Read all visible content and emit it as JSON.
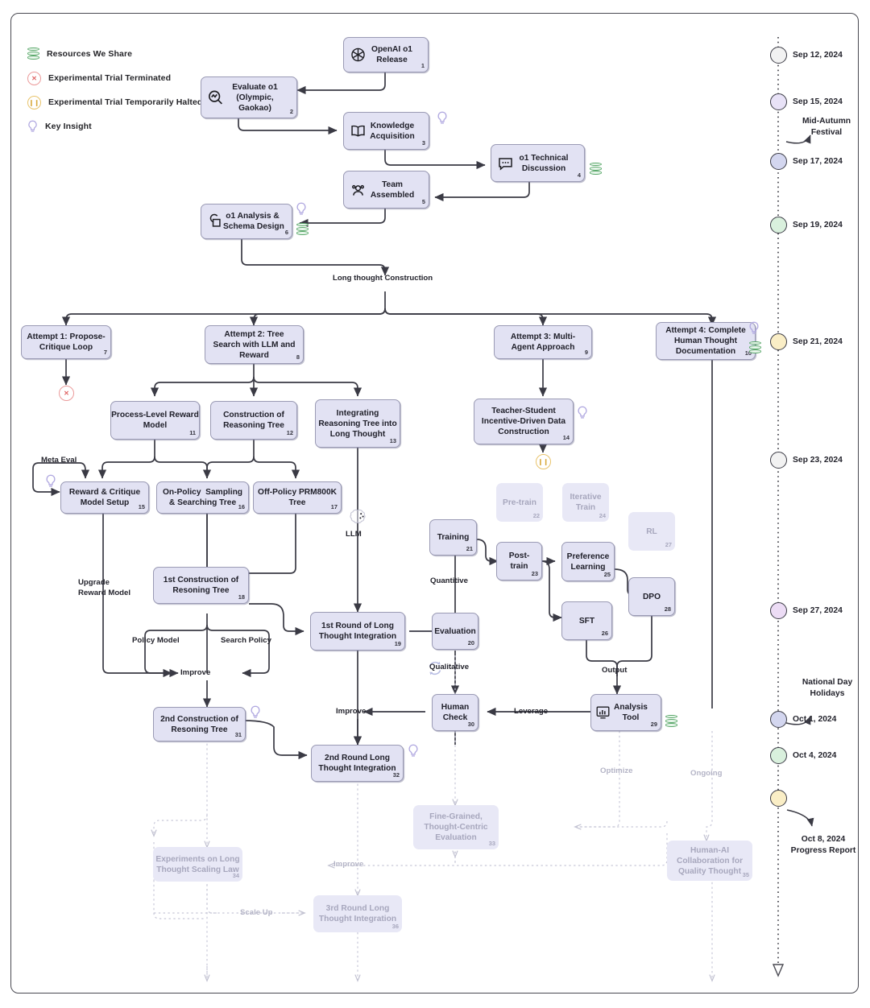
{
  "legend": {
    "items": [
      {
        "icon": "database-icon",
        "label": "Resources We Share"
      },
      {
        "icon": "x-circle-icon",
        "label": "Experimental Trial Terminated"
      },
      {
        "icon": "pause-circle-icon",
        "label": "Experimental Trial Temporarily Halted"
      },
      {
        "icon": "lightbulb-icon",
        "label": "Key Insight"
      }
    ]
  },
  "colors": {
    "node_fill": "#e2e2f3",
    "node_border": "#9a9ab4",
    "ghost_fill": "#e8e8f6",
    "ghost_text": "#a7a7bd",
    "resource_green": "#5aa86a",
    "terminated_red": "#eb9a9a",
    "halted_yellow": "#e8c36a",
    "insight_purple": "#b0a8e0",
    "wire": "#3a3a44"
  },
  "nodes": [
    {
      "id": 1,
      "label": "OpenAI o1\nRelease",
      "icon": "openai-logo-icon",
      "state": "active"
    },
    {
      "id": 2,
      "label": "Evaluate o1\n(Olympic,\nGaokao)",
      "icon": "evaluate-icon",
      "state": "active"
    },
    {
      "id": 3,
      "label": "Knowledge\nAcquisition",
      "icon": "book-icon",
      "state": "active",
      "insight": true
    },
    {
      "id": 4,
      "label": "o1 Technical\nDiscussion",
      "icon": "chat-icon",
      "state": "active",
      "resource": true
    },
    {
      "id": 5,
      "label": "Team\nAssembled",
      "icon": "team-icon",
      "state": "active"
    },
    {
      "id": 6,
      "label": "o1 Analysis &\nSchema Design",
      "icon": "schema-icon",
      "state": "active",
      "insight": true,
      "resource": true
    },
    {
      "id": 7,
      "label": "Attempt 1: Propose-\nCritique Loop",
      "state": "active"
    },
    {
      "id": 8,
      "label": "Attempt 2: Tree\nSearch with LLM and\nReward",
      "state": "active"
    },
    {
      "id": 9,
      "label": "Attempt 3: Multi-\nAgent Approach",
      "state": "active"
    },
    {
      "id": 10,
      "label": "Attempt 4: Complete\nHuman Thought\nDocumentation",
      "state": "active",
      "insight": true,
      "resource": true
    },
    {
      "id": 11,
      "label": "Process-Level Reward\nModel",
      "state": "active"
    },
    {
      "id": 12,
      "label": "Construction of\nReasoning Tree",
      "state": "active"
    },
    {
      "id": 13,
      "label": "Integrating\nReasoning Tree into\nLong Thought",
      "state": "active"
    },
    {
      "id": 14,
      "label": "Teacher-Student\nIncentive-Driven Data\nConstruction",
      "state": "active",
      "insight": true
    },
    {
      "id": 15,
      "label": "Reward & Critique\nModel Setup",
      "state": "active"
    },
    {
      "id": 16,
      "label": "On-Policy  Sampling\n& Searching Tree",
      "state": "active"
    },
    {
      "id": 17,
      "label": "Off-Policy PRM800K\nTree",
      "state": "active"
    },
    {
      "id": 18,
      "label": "1st Construction of\nResoning Tree",
      "state": "active"
    },
    {
      "id": 19,
      "label": "1st Round of Long\nThought Integration",
      "state": "active"
    },
    {
      "id": 20,
      "label": "Evaluation",
      "state": "active"
    },
    {
      "id": 21,
      "label": "Training",
      "state": "active"
    },
    {
      "id": 22,
      "label": "Pre-train",
      "state": "ghost"
    },
    {
      "id": 23,
      "label": "Post-train",
      "state": "active"
    },
    {
      "id": 24,
      "label": "Iterative\nTrain",
      "state": "ghost"
    },
    {
      "id": 25,
      "label": "Preference\nLearning",
      "state": "active"
    },
    {
      "id": 26,
      "label": "SFT",
      "state": "active"
    },
    {
      "id": 27,
      "label": "RL",
      "state": "ghost"
    },
    {
      "id": 28,
      "label": "DPO",
      "state": "active"
    },
    {
      "id": 29,
      "label": "Analysis\nTool",
      "icon": "analysis-tool-icon",
      "state": "active",
      "resource": true
    },
    {
      "id": 30,
      "label": "Human\nCheck",
      "state": "active"
    },
    {
      "id": 31,
      "label": "2nd Construction of\nResoning Tree",
      "state": "active",
      "insight": true
    },
    {
      "id": 32,
      "label": "2nd Round Long\nThought Integration",
      "state": "active",
      "insight": true
    },
    {
      "id": 33,
      "label": "Fine-Grained,\nThought-Centric\nEvaluation",
      "state": "ghost"
    },
    {
      "id": 34,
      "label": "Experiments on Long\nThought Scaling Law",
      "state": "ghost"
    },
    {
      "id": 35,
      "label": "Human-AI\nCollaboration for\nQuality Thought",
      "state": "ghost"
    },
    {
      "id": 36,
      "label": "3rd Round Long\nThought Integration",
      "state": "ghost"
    }
  ],
  "edge_labels": [
    {
      "key": "long_thought_construction",
      "text": "Long thought Construction",
      "state": "active"
    },
    {
      "key": "meta_eval",
      "text": "Meta Eval",
      "state": "active"
    },
    {
      "key": "llm",
      "text": "LLM",
      "state": "active"
    },
    {
      "key": "upgrade_reward_model",
      "text": "Upgrade\nReward Model",
      "state": "active"
    },
    {
      "key": "policy_model",
      "text": "Policy Model",
      "state": "active"
    },
    {
      "key": "search_policy",
      "text": "Search Policy",
      "state": "active"
    },
    {
      "key": "improve_1",
      "text": "Improve",
      "state": "active"
    },
    {
      "key": "quantitive",
      "text": "Quantitive",
      "state": "active"
    },
    {
      "key": "qualitative",
      "text": "Qualitative",
      "state": "active"
    },
    {
      "key": "output",
      "text": "Output",
      "state": "active"
    },
    {
      "key": "leverage",
      "text": "Leverage",
      "state": "active"
    },
    {
      "key": "improve_2",
      "text": "Improve",
      "state": "active"
    },
    {
      "key": "optimize",
      "text": "Optimize",
      "state": "ghost"
    },
    {
      "key": "ongoing",
      "text": "Ongoing",
      "state": "ghost"
    },
    {
      "key": "improve_3",
      "text": "Improve",
      "state": "ghost"
    },
    {
      "key": "scale_up",
      "text": "Scale Up",
      "state": "ghost"
    }
  ],
  "timeline": {
    "events": [
      {
        "date": "Sep 12, 2024",
        "color": "#f2f2f2"
      },
      {
        "date": "Sep 15, 2024",
        "color": "#e8e2f7"
      },
      {
        "date": "Sep 17, 2024",
        "color": "#d3d6ef"
      },
      {
        "date": "Sep 19, 2024",
        "color": "#d9f0dd"
      },
      {
        "date": "Sep 21,  2024",
        "color": "#faeec6"
      },
      {
        "date": "Sep 23, 2024",
        "color": "#f2f2f2"
      },
      {
        "date": "Sep 27, 2024",
        "color": "#ecdcf5"
      },
      {
        "date": "Oct 1, 2024",
        "color": "#d3d6ef"
      },
      {
        "date": "Oct 4, 2024",
        "color": "#d9f0dd"
      },
      {
        "date": "",
        "color": "#faeec6"
      }
    ],
    "annotations": [
      {
        "key": "mid-autumn",
        "text": "Mid-Autumn\nFestival"
      },
      {
        "key": "national-day",
        "text": "National Day\nHolidays"
      },
      {
        "key": "progress-report",
        "text": "Oct 8, 2024\nProgress Report"
      }
    ]
  }
}
